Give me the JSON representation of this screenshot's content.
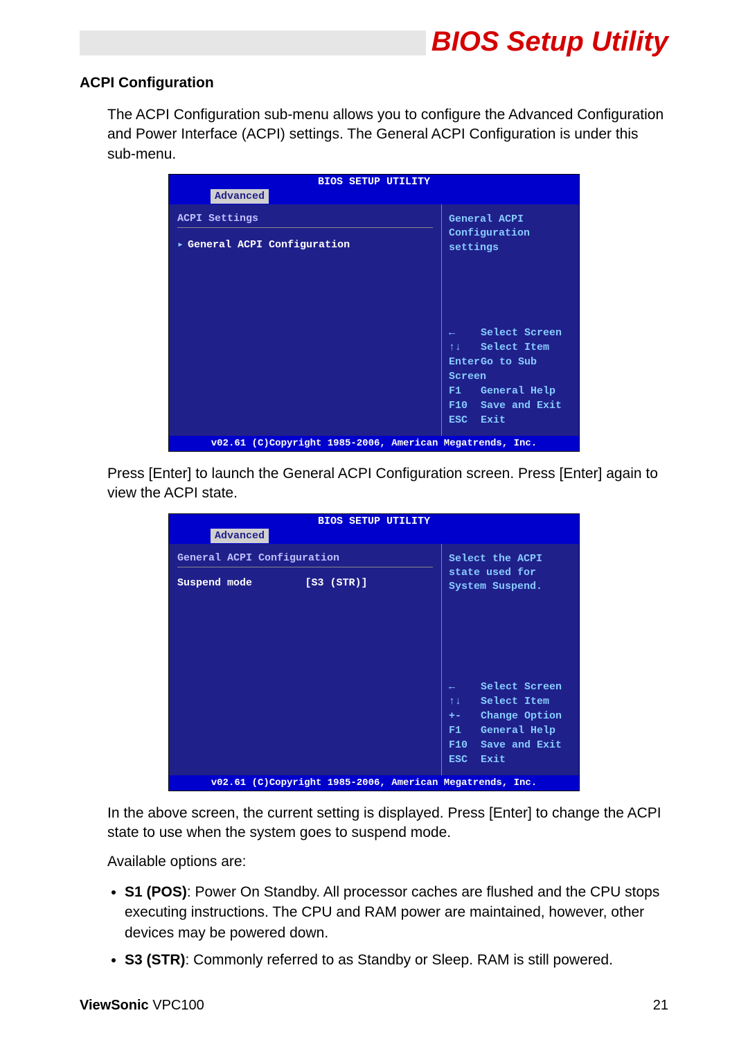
{
  "header": {
    "title": "BIOS Setup Utility"
  },
  "section_heading": "ACPI Configuration",
  "para1": "The ACPI Configuration sub-menu allows you to configure the Advanced Configuration and Power Interface (ACPI) settings. The General ACPI Configuration is under this sub-menu.",
  "bios1": {
    "title": "BIOS SETUP UTILITY",
    "tab": "Advanced",
    "left_heading": "ACPI Settings",
    "item1": "General ACPI Configuration",
    "help": "General ACPI Configuration settings",
    "keys": [
      {
        "k": "←",
        "t": "Select Screen"
      },
      {
        "k": "↑↓",
        "t": "Select Item"
      },
      {
        "k": "Enter",
        "t": "Go to Sub Screen"
      },
      {
        "k": "F1",
        "t": "General Help"
      },
      {
        "k": "F10",
        "t": "Save and Exit"
      },
      {
        "k": "ESC",
        "t": "Exit"
      }
    ],
    "footer": "v02.61 (C)Copyright 1985-2006, American Megatrends, Inc."
  },
  "para2": "Press [Enter] to launch the General ACPI Configuration screen.  Press [Enter] again to view the ACPI state.",
  "bios2": {
    "title": "BIOS SETUP UTILITY",
    "tab": "Advanced",
    "left_heading": "General ACPI Configuration",
    "setting_label": "Suspend mode",
    "setting_value": "[S3 (STR)]",
    "help": "Select the ACPI state used for System Suspend.",
    "keys": [
      {
        "k": "←",
        "t": "Select Screen"
      },
      {
        "k": "↑↓",
        "t": "Select Item"
      },
      {
        "k": "+-",
        "t": "Change Option"
      },
      {
        "k": "F1",
        "t": "General Help"
      },
      {
        "k": "F10",
        "t": "Save and Exit"
      },
      {
        "k": "ESC",
        "t": "Exit"
      }
    ],
    "footer": "v02.61 (C)Copyright 1985-2006, American Megatrends, Inc."
  },
  "para3": "In the above screen, the current setting is displayed. Press [Enter] to change the ACPI state to use when the system goes to suspend mode.",
  "para4": "Available options are:",
  "options": [
    {
      "bold": "S1 (POS)",
      "rest": ": Power On Standby. All processor caches are flushed and the CPU stops executing instructions. The CPU and RAM power are maintained, however, other devices may be powered down."
    },
    {
      "bold": "S3 (STR)",
      "rest": ": Commonly referred to as Standby or Sleep. RAM is still powered."
    }
  ],
  "footer": {
    "brand": "ViewSonic",
    "model": "VPC100",
    "page": "21"
  }
}
